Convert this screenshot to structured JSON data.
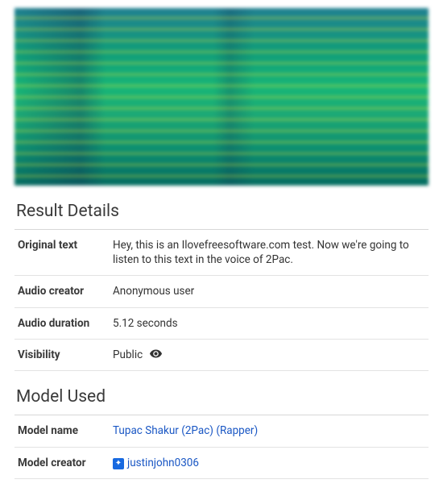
{
  "spectrogram": {
    "alt": "audio spectrogram"
  },
  "resultDetails": {
    "title": "Result Details",
    "rows": {
      "originalText": {
        "label": "Original text",
        "value": "Hey, this is an Ilovefreesoftware.com test. Now we're going to listen to this text in the voice of 2Pac."
      },
      "audioCreator": {
        "label": "Audio creator",
        "value": "Anonymous user"
      },
      "audioDuration": {
        "label": "Audio duration",
        "value": "5.12 seconds"
      },
      "visibility": {
        "label": "Visibility",
        "value": "Public"
      }
    }
  },
  "modelUsed": {
    "title": "Model Used",
    "rows": {
      "modelName": {
        "label": "Model name",
        "value": "Tupac Shakur (2Pac) (Rapper)"
      },
      "modelCreator": {
        "label": "Model creator",
        "value": "justinjohn0306"
      }
    }
  }
}
